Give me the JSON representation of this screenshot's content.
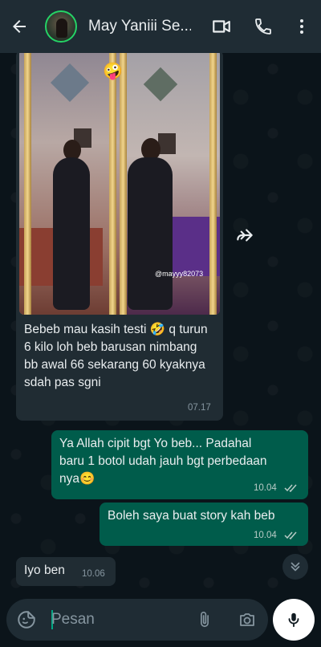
{
  "header": {
    "contact_name": "May Yaniii Se...",
    "icons": [
      "back-arrow-icon",
      "video-call-icon",
      "phone-call-icon",
      "more-options-icon"
    ]
  },
  "photo": {
    "watermark": "@mayyy82073"
  },
  "messages": [
    {
      "direction": "incoming",
      "text": "Bebeb mau kasih testi 🤣 q turun 6 kilo loh beb barusan nimbang bb awal 66 sekarang 60 kyaknya sdah pas sgni",
      "time": "07.17"
    },
    {
      "direction": "outgoing",
      "text": "Ya Allah cipit bgt Yo beb... Padahal baru 1 botol udah jauh bgt perbedaan nya😊",
      "time": "10.04"
    },
    {
      "direction": "outgoing",
      "text": "Boleh saya buat story kah beb",
      "time": "10.04"
    },
    {
      "direction": "incoming",
      "text": "Iyo ben",
      "time": "10.06"
    }
  ],
  "composer": {
    "placeholder": "Pesan"
  },
  "colors": {
    "header_bg": "#1f2c34",
    "chat_bg": "#0b141a",
    "incoming_bubble": "#202c33",
    "outgoing_bubble": "#005c4b",
    "accent": "#00a884"
  }
}
